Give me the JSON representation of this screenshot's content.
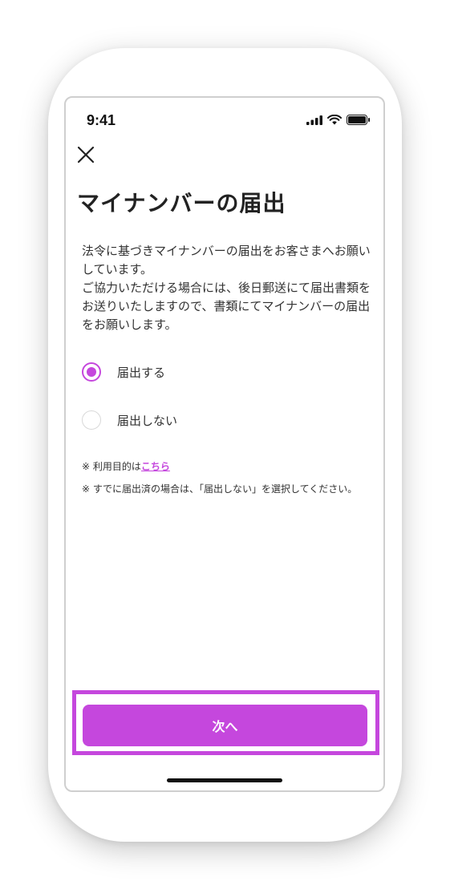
{
  "status_bar": {
    "time": "9:41"
  },
  "header": {
    "close_icon": "close-icon",
    "title": "マイナンバーの届出"
  },
  "description": "法令に基づきマイナンバーの届出をお客さまへお願いしています。\nご協力いただける場合には、後日郵送にて届出書類をお送りいたしますので、書類にてマイナンバーの届出をお願いします。",
  "options": [
    {
      "label": "届出する",
      "selected": true
    },
    {
      "label": "届出しない",
      "selected": false
    }
  ],
  "notes": {
    "purpose_prefix": "※ 利用目的は",
    "purpose_link": "こちら",
    "already_submitted": "※ すでに届出済の場合は、「届出しない」を選択してください。"
  },
  "footer": {
    "next_label": "次へ"
  },
  "colors": {
    "accent": "#c547dd",
    "text": "#333333",
    "title": "#222222"
  }
}
